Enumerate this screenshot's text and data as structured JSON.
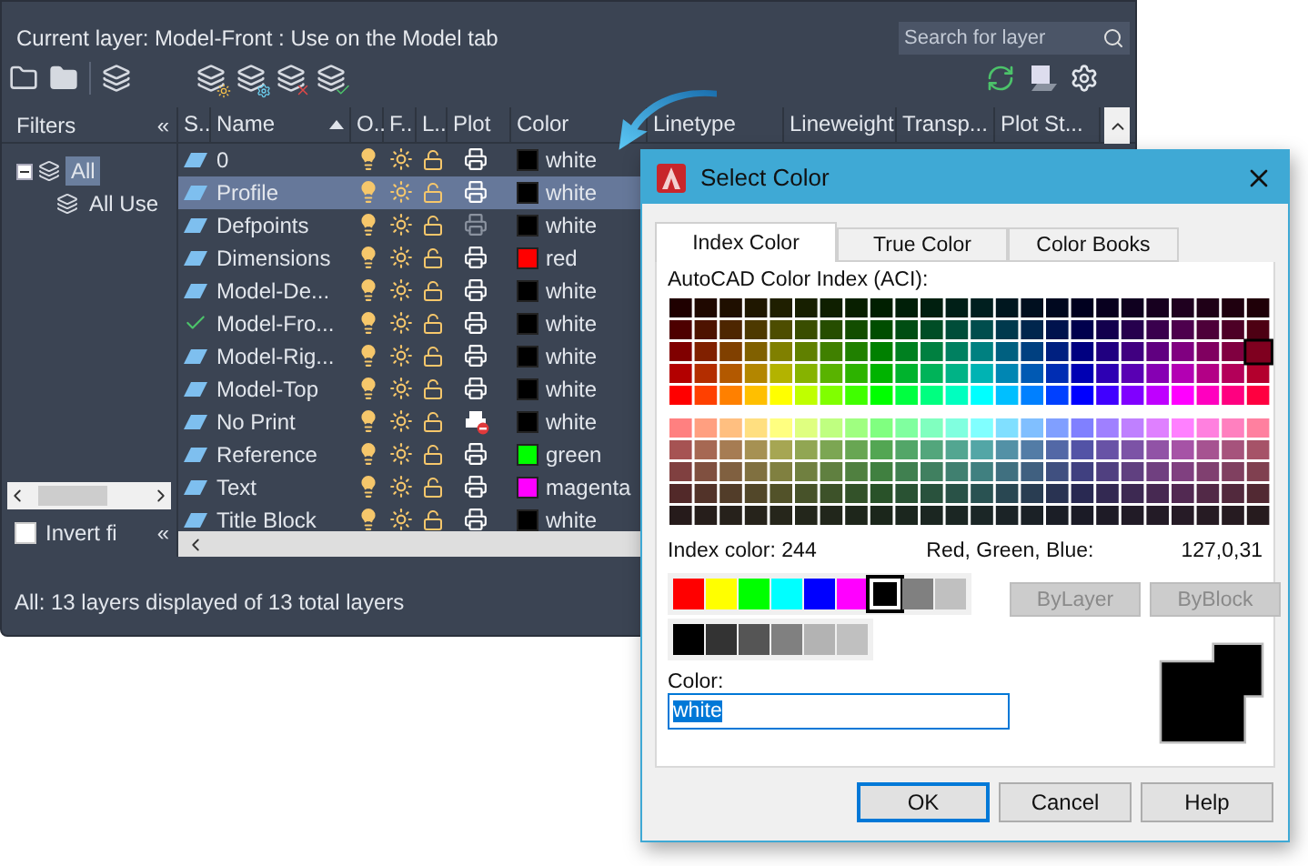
{
  "layer_manager": {
    "current_layer": "Current layer: Model-Front : Use on the Model tab",
    "search": {
      "placeholder": "Search for layer"
    },
    "filters": {
      "title": "Filters",
      "collapse": "«",
      "tree": [
        {
          "label": "All",
          "selected": true,
          "expanded": true,
          "children": [
            {
              "label": "All Use",
              "selected": false
            }
          ]
        }
      ],
      "invert": {
        "label": "Invert fi",
        "checked": false
      },
      "invert_collapse": "«"
    },
    "table": {
      "columns": [
        "S..",
        "Name",
        "O..",
        "F..",
        "L..",
        "Plot",
        "Color",
        "Linetype",
        "Lineweight",
        "Transp...",
        "Plot St..."
      ],
      "rows": [
        {
          "status": {
            "kind": "layer"
          },
          "name": "0",
          "selected": false,
          "plot": {
            "kind": "normal"
          },
          "color_name": "white",
          "color": "#000000"
        },
        {
          "status": {
            "kind": "layer"
          },
          "name": "Profile",
          "selected": true,
          "plot": {
            "kind": "normal"
          },
          "color_name": "white",
          "color": "#000000"
        },
        {
          "status": {
            "kind": "layer"
          },
          "name": "Defpoints",
          "selected": false,
          "plot": {
            "kind": "dimmed"
          },
          "color_name": "white",
          "color": "#000000"
        },
        {
          "status": {
            "kind": "layer"
          },
          "name": "Dimensions",
          "selected": false,
          "plot": {
            "kind": "normal"
          },
          "color_name": "red",
          "color": "#ff0000"
        },
        {
          "status": {
            "kind": "layer"
          },
          "name": "Model-De...",
          "selected": false,
          "plot": {
            "kind": "normal"
          },
          "color_name": "white",
          "color": "#000000"
        },
        {
          "status": {
            "kind": "current"
          },
          "name": "Model-Fro...",
          "selected": false,
          "plot": {
            "kind": "normal"
          },
          "color_name": "white",
          "color": "#000000"
        },
        {
          "status": {
            "kind": "layer"
          },
          "name": "Model-Rig...",
          "selected": false,
          "plot": {
            "kind": "normal"
          },
          "color_name": "white",
          "color": "#000000"
        },
        {
          "status": {
            "kind": "layer"
          },
          "name": "Model-Top",
          "selected": false,
          "plot": {
            "kind": "normal"
          },
          "color_name": "white",
          "color": "#000000"
        },
        {
          "status": {
            "kind": "layer"
          },
          "name": "No Print",
          "selected": false,
          "plot": {
            "kind": "blocked"
          },
          "color_name": "white",
          "color": "#000000"
        },
        {
          "status": {
            "kind": "layer"
          },
          "name": "Reference",
          "selected": false,
          "plot": {
            "kind": "normal"
          },
          "color_name": "green",
          "color": "#00ff00"
        },
        {
          "status": {
            "kind": "layer"
          },
          "name": "Text",
          "selected": false,
          "plot": {
            "kind": "normal"
          },
          "color_name": "magenta",
          "color": "#ff00ff"
        },
        {
          "status": {
            "kind": "layer"
          },
          "name": "Title Block",
          "selected": false,
          "plot": {
            "kind": "normal"
          },
          "color_name": "white",
          "color": "#000000"
        }
      ]
    },
    "status_bar": "All: 13 layers displayed of 13 total layers"
  },
  "dialog": {
    "title": "Select Color",
    "tabs": [
      {
        "label": "Index Color",
        "selected": true
      },
      {
        "label": "True Color",
        "selected": false
      },
      {
        "label": "Color Books",
        "selected": false
      }
    ],
    "palette_label": "AutoCAD Color Index (ACI):",
    "index_label": "Index color:",
    "index_value": "244",
    "rgb_label": "Red, Green, Blue:",
    "rgb_value": "127,0,31",
    "standard_colors": [
      {
        "color": "#ff0000",
        "selected": false
      },
      {
        "color": "#ffff00",
        "selected": false
      },
      {
        "color": "#00ff00",
        "selected": false
      },
      {
        "color": "#00ffff",
        "selected": false
      },
      {
        "color": "#0000ff",
        "selected": false
      },
      {
        "color": "#ff00ff",
        "selected": false
      },
      {
        "color": "#000000",
        "selected": true
      },
      {
        "color": "#808080",
        "selected": false
      },
      {
        "color": "#c0c0c0",
        "selected": false
      }
    ],
    "gray_colors": [
      {
        "color": "#000000",
        "selected": false
      },
      {
        "color": "#333333",
        "selected": false
      },
      {
        "color": "#555555",
        "selected": false
      },
      {
        "color": "#808080",
        "selected": false
      },
      {
        "color": "#b3b3b3",
        "selected": false
      },
      {
        "color": "#c0c0c0",
        "selected": false
      }
    ],
    "bylayer": {
      "label": "ByLayer",
      "disabled": true
    },
    "byblock": {
      "label": "ByBlock",
      "disabled": true
    },
    "color_field": {
      "label": "Color:",
      "value": "white"
    },
    "preview": {
      "color": "#000000"
    },
    "buttons": [
      {
        "label": "OK",
        "default": true
      },
      {
        "label": "Cancel",
        "default": false
      },
      {
        "label": "Help",
        "default": false
      }
    ]
  }
}
